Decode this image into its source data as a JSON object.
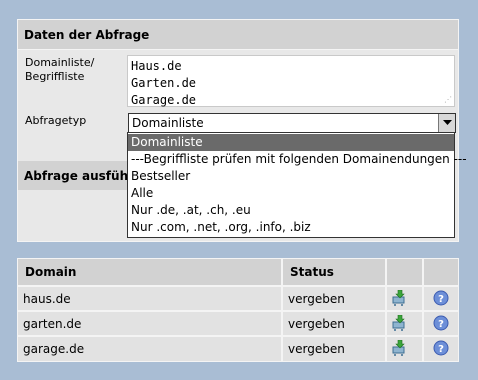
{
  "query_panel": {
    "title": "Daten der Abfrage",
    "domain_label_1": "Domainliste/",
    "domain_label_2": "Begriffliste",
    "domain_lines": [
      "Haus.de",
      "Garten.de",
      "Garage.de"
    ],
    "type_label": "Abfragetyp",
    "type_selected": "Domainliste",
    "type_options": [
      "Domainliste",
      "---Begriffliste prüfen mit folgenden Domainendungen ---",
      "Bestseller",
      "Alle",
      "Nur .de, .at, .ch, .eu",
      "Nur .com, .net, .org, .info, .biz"
    ],
    "execute_title": "Abfrage ausführen"
  },
  "results": {
    "headers": {
      "domain": "Domain",
      "status": "Status"
    },
    "rows": [
      {
        "domain": "haus.de",
        "status": "vergeben"
      },
      {
        "domain": "garten.de",
        "status": "vergeben"
      },
      {
        "domain": "garage.de",
        "status": "vergeben"
      }
    ]
  },
  "icons": {
    "download": "cart-download-icon",
    "info": "info-icon"
  },
  "colors": {
    "background": "#a9bdd4",
    "panel": "#e8e8e8",
    "header": "#d2d2d2",
    "selected_option": "#6a6a6a"
  }
}
